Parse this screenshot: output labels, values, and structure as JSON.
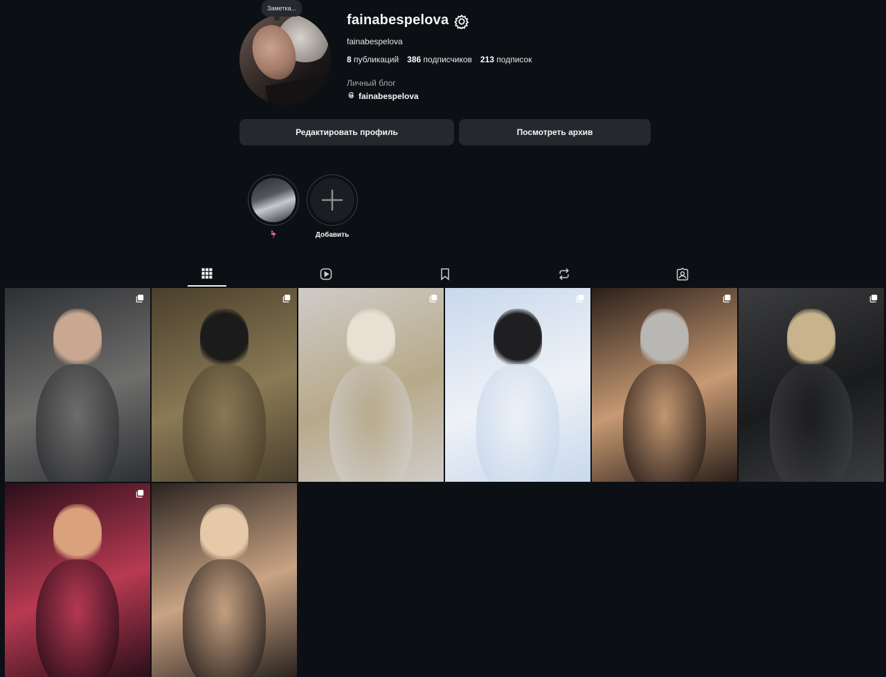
{
  "profile": {
    "note": "Заметка...",
    "username": "fainabespelova",
    "full_name": "fainabespelova",
    "stats": [
      {
        "count": "8",
        "label": "публикаций"
      },
      {
        "count": "386",
        "label": "подписчиков"
      },
      {
        "count": "213",
        "label": "подписок"
      }
    ],
    "category": "Личный блог",
    "threads_handle": "fainabespelova"
  },
  "actions": {
    "edit_profile": "Редактировать профиль",
    "view_archive": "Посмотреть архив"
  },
  "highlights": [
    {
      "label": "🦩"
    },
    {
      "label": "Добавить"
    }
  ],
  "tabs": [
    {
      "icon": "grid-icon",
      "active": true
    },
    {
      "icon": "reels-icon",
      "active": false
    },
    {
      "icon": "saved-icon",
      "active": false
    },
    {
      "icon": "reposts-icon",
      "active": false
    },
    {
      "icon": "tagged-icon",
      "active": false
    }
  ],
  "posts": [
    {
      "description_icon": "carousel-icon",
      "palette": [
        "#2d2f33",
        "#6f6e6c",
        "#caa791"
      ]
    },
    {
      "description_icon": "carousel-icon",
      "palette": [
        "#4a3f2c",
        "#8a7a55",
        "#1b1b1c"
      ]
    },
    {
      "description_icon": "carousel-icon",
      "palette": [
        "#cfcbc7",
        "#b7a98a",
        "#e8e0d2"
      ]
    },
    {
      "description_icon": "carousel-icon",
      "palette": [
        "#c9d8ec",
        "#eef2f7",
        "#1f1f22"
      ]
    },
    {
      "description_icon": "carousel-icon",
      "palette": [
        "#2a1f1a",
        "#c79a73",
        "#b9b7b3"
      ]
    },
    {
      "description_icon": "carousel-icon",
      "palette": [
        "#3b3c3e",
        "#1a1b1d",
        "#c9b38c"
      ]
    },
    {
      "description_icon": "carousel-icon",
      "palette": [
        "#2b0e1a",
        "#b83a52",
        "#d9a27d"
      ]
    },
    {
      "description_icon": "none",
      "palette": [
        "#2a2320",
        "#c9a383",
        "#e5c9a9"
      ]
    }
  ],
  "colors": {
    "background": "#0c1014",
    "button": "#25292e",
    "text": "#f5f5f5",
    "muted": "#a8a8a8"
  }
}
